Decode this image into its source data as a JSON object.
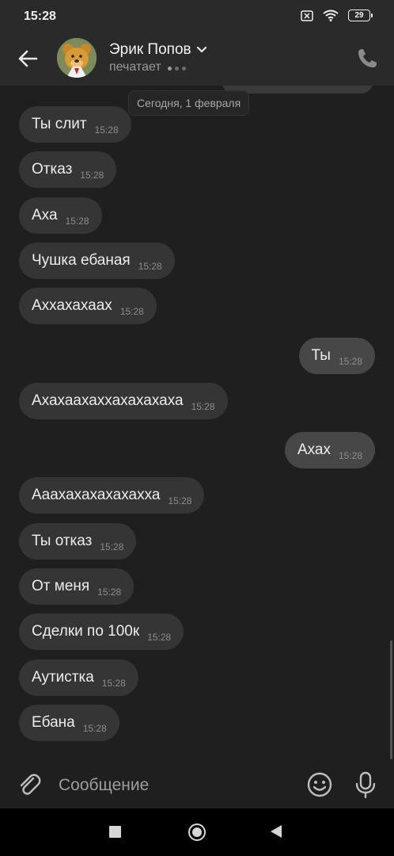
{
  "status_bar": {
    "time": "15:28",
    "battery": "29"
  },
  "header": {
    "contact_name": "Эрик Попов",
    "status": "печатает",
    "back_icon": "arrow-left-icon",
    "call_icon": "phone-icon",
    "chevron_icon": "chevron-down-icon"
  },
  "chat": {
    "date_divider": "Сегодня, 1 февраля",
    "messages": [
      {
        "dir": "in",
        "text": "Ты слит",
        "time": "15:28"
      },
      {
        "dir": "in",
        "text": "Отказ",
        "time": "15:28"
      },
      {
        "dir": "in",
        "text": "Аха",
        "time": "15:28"
      },
      {
        "dir": "in",
        "text": "Чушка ебаная",
        "time": "15:28"
      },
      {
        "dir": "in",
        "text": "Аххахахаах",
        "time": "15:28"
      },
      {
        "dir": "out",
        "text": "Ты",
        "time": "15:28"
      },
      {
        "dir": "in",
        "text": "Ахахаахаххахахахаха",
        "time": "15:28"
      },
      {
        "dir": "out",
        "text": "Ахах",
        "time": "15:28"
      },
      {
        "dir": "in",
        "text": "Аaахахахахахахха",
        "time": "15:28"
      },
      {
        "dir": "in",
        "text": "Ты отказ",
        "time": "15:28"
      },
      {
        "dir": "in",
        "text": "От меня",
        "time": "15:28"
      },
      {
        "dir": "in",
        "text": "Сделки по 100к",
        "time": "15:28"
      },
      {
        "dir": "in",
        "text": "Аутистка",
        "time": "15:28"
      },
      {
        "dir": "in",
        "text": "Ебана",
        "time": "15:28"
      }
    ]
  },
  "composer": {
    "placeholder": "Сообщение",
    "attach_icon": "paperclip-icon",
    "emoji_icon": "smiley-icon",
    "mic_icon": "microphone-icon"
  },
  "colors": {
    "background": "#1f1f1f",
    "header": "#2a2a2a",
    "incoming_bubble": "#353535",
    "outgoing_bubble": "#474747"
  }
}
